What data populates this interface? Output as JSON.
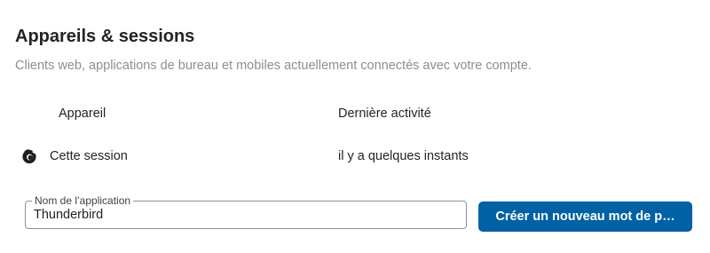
{
  "section": {
    "title": "Appareils & sessions",
    "description": "Clients web, applications de bureau et mobiles actuellement connectés avec votre compte."
  },
  "table": {
    "headers": {
      "device": "Appareil",
      "last_activity": "Dernière activité"
    },
    "rows": [
      {
        "icon": "firefox-browser-icon",
        "device": "Cette session",
        "last_activity": "il y a quelques instants"
      }
    ]
  },
  "app_password_form": {
    "field_label": "Nom de l’application",
    "field_value": "Thunderbird",
    "button_label": "Créer un nouveau mot de p…"
  },
  "colors": {
    "button_background": "#0061a4",
    "description_text": "#8d8e93"
  }
}
